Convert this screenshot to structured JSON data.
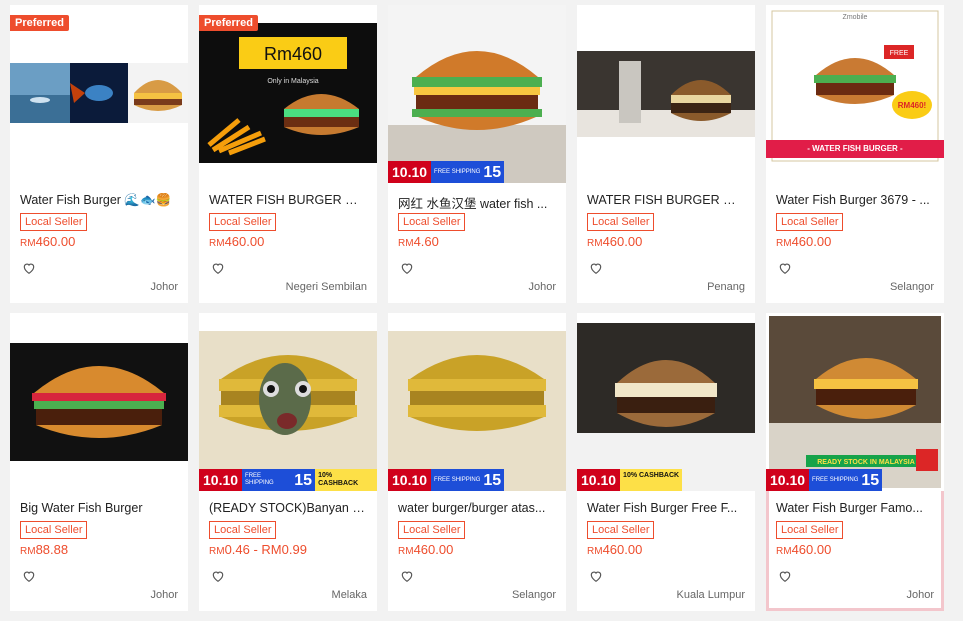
{
  "products": [
    {
      "name": "Water Fish Burger 🌊🐟🍔",
      "preferred": "Preferred",
      "seller": "Local Seller",
      "currency": "RM",
      "price": "460.00",
      "location": "Johor",
      "promo": null,
      "image": "fish-photo-collage"
    },
    {
      "name": "WATER FISH BURGER 🍔 ...",
      "preferred": "Preferred",
      "seller": "Local Seller",
      "currency": "RM",
      "price": "460.00",
      "location": "Negeri Sembilan",
      "promo": null,
      "image": "dark-burger-ad",
      "image_text": [
        "Rm460",
        "Only in Malaysia"
      ]
    },
    {
      "name": "网红 水鱼汉堡 water fish ...",
      "preferred": null,
      "seller": "Local Seller",
      "currency": "RM",
      "price": "4.60",
      "location": "Johor",
      "promo": {
        "label": "10.10",
        "free": "FREE SHIPPING",
        "num": "15",
        "cashback": null
      },
      "image": "classic-burger"
    },
    {
      "name": "WATER FISH BURGER 💧 ...",
      "preferred": null,
      "seller": "Local Seller",
      "currency": "RM",
      "price": "460.00",
      "location": "Penang",
      "promo": null,
      "image": "restaurant-burger"
    },
    {
      "name": "Water Fish Burger 3679 - ...",
      "preferred": null,
      "seller": "Local Seller",
      "currency": "RM",
      "price": "460.00",
      "location": "Selangor",
      "promo": null,
      "image": "zmobile-burger",
      "image_text": [
        "Zmobile",
        "FREE",
        "RM460!",
        "- WATER FISH BURGER -"
      ]
    },
    {
      "name": "Big Water Fish Burger",
      "preferred": null,
      "seller": "Local Seller",
      "currency": "RM",
      "price": "88.88",
      "location": "Johor",
      "promo": null,
      "image": "dark-bg-burger"
    },
    {
      "name": "(READY STOCK)Banyan L...",
      "preferred": null,
      "seller": "Local Seller",
      "currency": "RM",
      "price": "0.46 - RM0.99",
      "location": "Melaka",
      "promo": {
        "label": "10.10",
        "free": "FREE SHIPPING",
        "num": "15",
        "cashback": "10% CASHBACK"
      },
      "image": "gold-burger-fish"
    },
    {
      "name": "water burger/burger atas...",
      "preferred": null,
      "seller": "Local Seller",
      "currency": "RM",
      "price": "460.00",
      "location": "Selangor",
      "promo": {
        "label": "10.10",
        "free": "FREE SHIPPING",
        "num": "15",
        "cashback": null
      },
      "image": "gold-burger"
    },
    {
      "name": "Water Fish Burger Free F...",
      "preferred": null,
      "seller": "Local Seller",
      "currency": "RM",
      "price": "460.00",
      "location": "Kuala Lumpur",
      "promo": {
        "label": "10.10",
        "free": null,
        "num": null,
        "cashback": "10% CASHBACK"
      },
      "image": "tall-burger"
    },
    {
      "name": "Water Fish Burger Famo...",
      "preferred": null,
      "seller": "Local Seller",
      "currency": "RM",
      "price": "460.00",
      "location": "Johor",
      "promo": {
        "label": "10.10",
        "free": "FREE SHIPPING",
        "num": "15",
        "cashback": null
      },
      "image": "restaurant-burger-2",
      "image_text": [
        "READY STOCK IN MALAYSIA"
      ]
    }
  ]
}
